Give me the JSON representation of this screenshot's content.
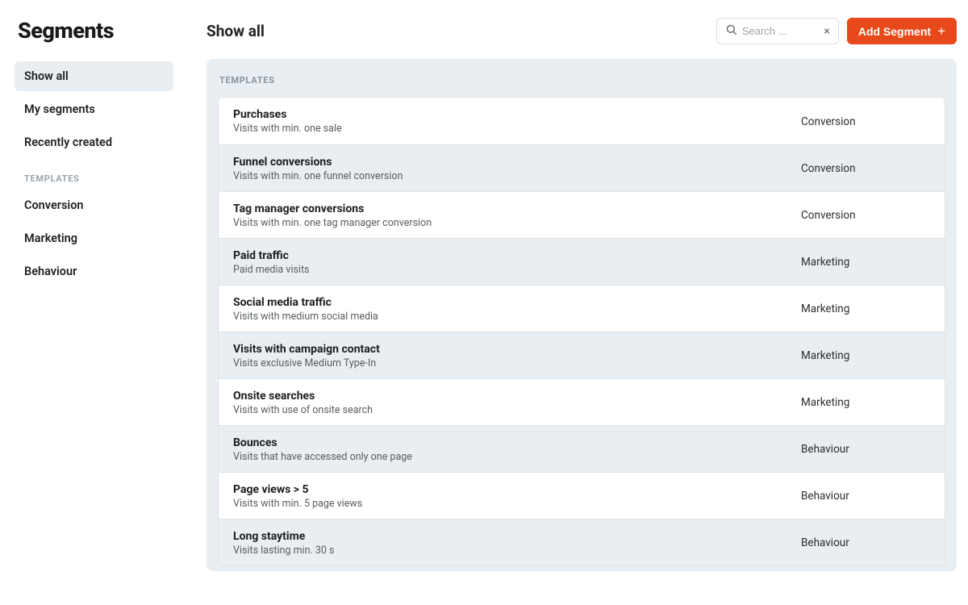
{
  "page_title": "Segments",
  "sidebar": {
    "nav": [
      {
        "label": "Show all",
        "active": true
      },
      {
        "label": "My segments",
        "active": false
      },
      {
        "label": "Recently created",
        "active": false
      }
    ],
    "templates_header": "TEMPLATES",
    "templates": [
      {
        "label": "Conversion"
      },
      {
        "label": "Marketing"
      },
      {
        "label": "Behaviour"
      }
    ]
  },
  "header": {
    "view_title": "Show all",
    "search_placeholder": "Search ...",
    "search_value": "",
    "clear_glyph": "×",
    "add_label": "Add Segment",
    "plus_glyph": "+"
  },
  "panel": {
    "section_header": "TEMPLATES",
    "rows": [
      {
        "title": "Purchases",
        "desc": "Visits with min. one sale",
        "category": "Conversion"
      },
      {
        "title": "Funnel conversions",
        "desc": "Visits with min. one funnel conversion",
        "category": "Conversion"
      },
      {
        "title": "Tag manager conversions",
        "desc": "Visits with min. one tag manager conversion",
        "category": "Conversion"
      },
      {
        "title": "Paid traffic",
        "desc": "Paid media visits",
        "category": "Marketing"
      },
      {
        "title": "Social media traffic",
        "desc": "Visits with medium social media",
        "category": "Marketing"
      },
      {
        "title": "Visits with campaign contact",
        "desc": "Visits exclusive Medium Type-In",
        "category": "Marketing"
      },
      {
        "title": "Onsite searches",
        "desc": "Visits with use of onsite search",
        "category": "Marketing"
      },
      {
        "title": "Bounces",
        "desc": "Visits that have accessed only one page",
        "category": "Behaviour"
      },
      {
        "title": "Page views > 5",
        "desc": "Visits with min. 5 page views",
        "category": "Behaviour"
      },
      {
        "title": "Long staytime",
        "desc": "Visits lasting min. 30 s",
        "category": "Behaviour"
      }
    ]
  }
}
